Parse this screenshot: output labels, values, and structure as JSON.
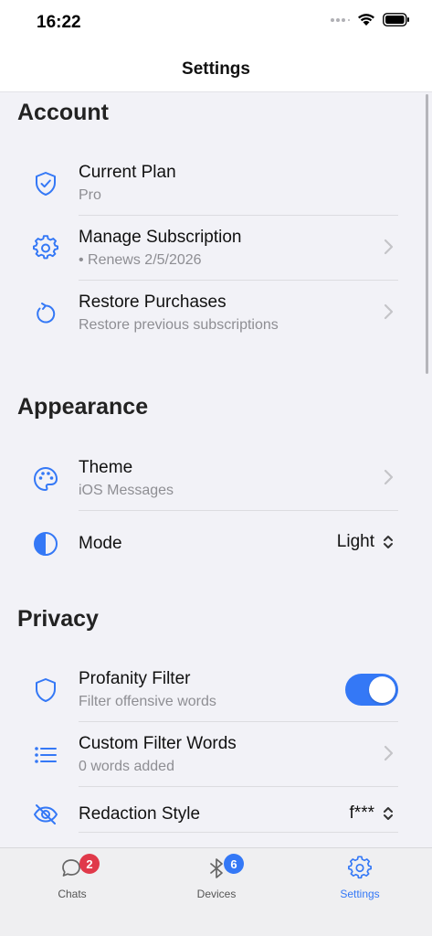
{
  "status": {
    "time": "16:22"
  },
  "nav": {
    "title": "Settings"
  },
  "colors": {
    "accent": "#3478f6",
    "badge_red": "#e0394a",
    "badge_blue": "#3478f6"
  },
  "sections": {
    "account": {
      "header": "Account",
      "rows": [
        {
          "title": "Current Plan",
          "subtitle": "Pro",
          "icon": "shield-check-icon"
        },
        {
          "title": "Manage Subscription",
          "subtitle": "• Renews 2/5/2026",
          "icon": "gear-icon"
        },
        {
          "title": "Restore Purchases",
          "subtitle": "Restore previous subscriptions",
          "icon": "refresh-icon"
        }
      ]
    },
    "appearance": {
      "header": "Appearance",
      "rows": [
        {
          "title": "Theme",
          "subtitle": "iOS Messages",
          "icon": "palette-icon"
        },
        {
          "title": "Mode",
          "value": "Light",
          "icon": "half-circle-icon"
        }
      ]
    },
    "privacy": {
      "header": "Privacy",
      "rows": [
        {
          "title": "Profanity Filter",
          "subtitle": "Filter offensive words",
          "icon": "shield-icon",
          "toggle": true
        },
        {
          "title": "Custom Filter Words",
          "subtitle": "0 words added",
          "icon": "list-icon"
        },
        {
          "title": "Redaction Style",
          "value": "f***",
          "icon": "eye-slash-icon"
        }
      ]
    }
  },
  "tabs": [
    {
      "label": "Chats",
      "badge": "2"
    },
    {
      "label": "Devices",
      "badge": "6"
    },
    {
      "label": "Settings"
    }
  ]
}
